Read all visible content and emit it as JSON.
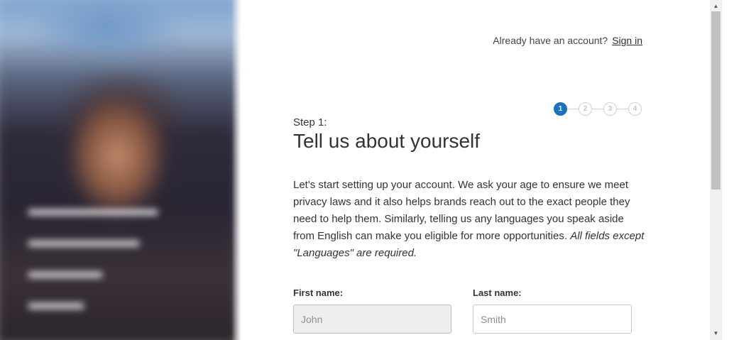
{
  "signin": {
    "prompt": "Already have an account?",
    "link": "Sign in"
  },
  "stepper": {
    "steps": [
      "1",
      "2",
      "3",
      "4"
    ],
    "current": 1,
    "active_color": "#1a73c1"
  },
  "step": {
    "label": "Step 1:",
    "title": "Tell us about yourself",
    "intro": "Let's start setting up your account. We ask your age to ensure we meet privacy laws and it also helps brands reach out to the exact people they need to help them. Similarly, telling us any languages you speak aside from English can make you eligible for more opportunities.",
    "note": "All fields except \"Languages\" are required."
  },
  "form": {
    "first_name_label": "First name:",
    "first_name_placeholder": "John",
    "last_name_label": "Last name:",
    "last_name_placeholder": "Smith"
  },
  "scrollbar": {
    "up_icon": "arrow-up-icon",
    "down_icon": "arrow-down-icon"
  }
}
